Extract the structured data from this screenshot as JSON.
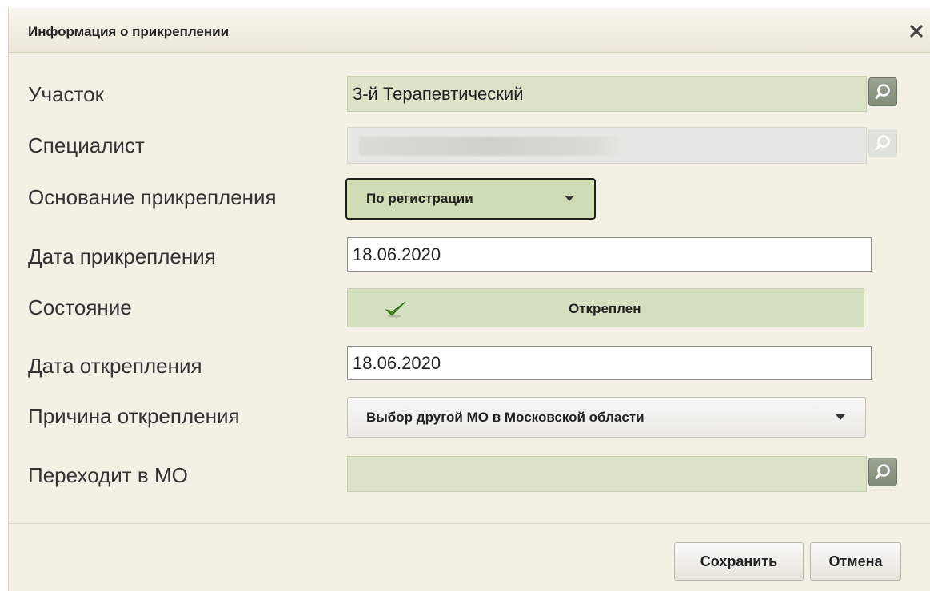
{
  "dialog": {
    "title": "Информация о прикреплении",
    "close_icon": "close-icon"
  },
  "form": {
    "uchastok": {
      "label": "Участок",
      "value": "3-й Терапевтический"
    },
    "specialist": {
      "label": "Специалист",
      "value": ""
    },
    "osnovanie": {
      "label": "Основание прикрепления",
      "value": "По регистрации"
    },
    "data_prikrepleniya": {
      "label": "Дата прикрепления",
      "value": "18.06.2020"
    },
    "sostoyanie": {
      "label": "Состояние",
      "value": "Откреплен"
    },
    "data_otkrepleniya": {
      "label": "Дата открепления",
      "value": "18.06.2020"
    },
    "prichina": {
      "label": "Причина открепления",
      "value": "Выбор другой МО в Московской области"
    },
    "perehodit_v_mo": {
      "label": "Переходит в МО",
      "value": ""
    }
  },
  "footer": {
    "save_label": "Сохранить",
    "cancel_label": "Отмена"
  },
  "colors": {
    "dialog_bg": "#f3f0e5",
    "field_green": "#dbe3c9",
    "status_green": "#d5e0c0",
    "check_green": "#4a8a24"
  }
}
